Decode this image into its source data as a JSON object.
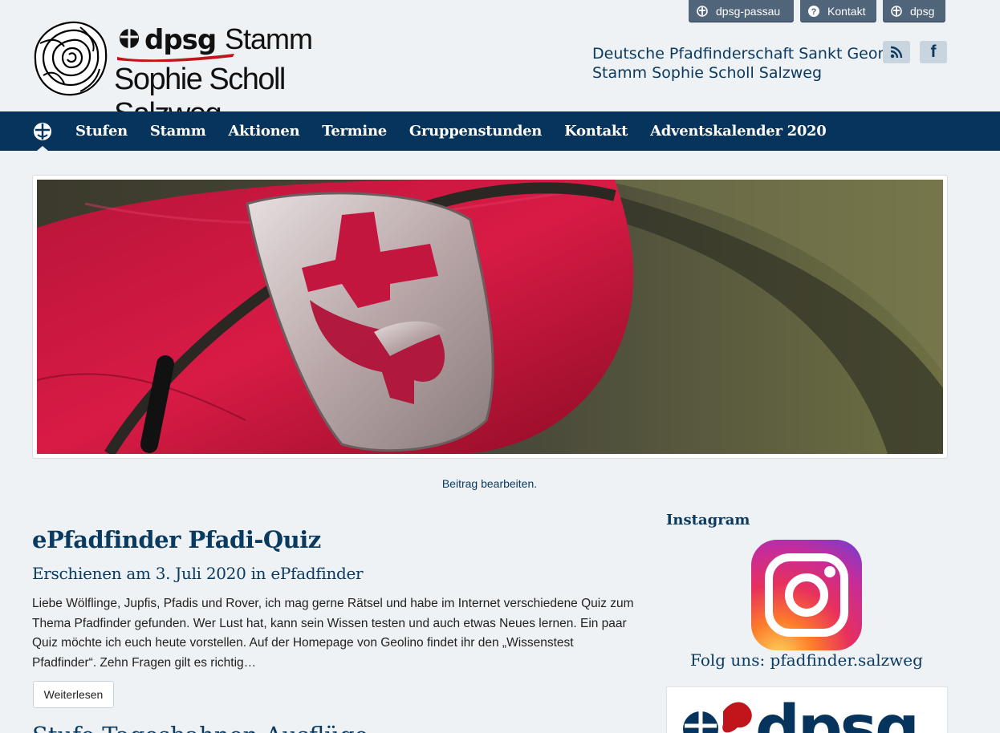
{
  "top_links": [
    {
      "label": "dpsg-passau",
      "icon": "lily-icon"
    },
    {
      "label": "Kontakt",
      "icon": "question-icon"
    },
    {
      "label": "dpsg",
      "icon": "lily-icon"
    }
  ],
  "logo": {
    "brand": "dpsg",
    "stamm": "Stamm",
    "name": "Sophie Scholl Salzweg"
  },
  "tagline": {
    "line1": "Deutsche Pfadfinderschaft Sankt Georg",
    "line2": "Stamm Sophie Scholl Salzweg"
  },
  "social": [
    {
      "icon": "rss-icon"
    },
    {
      "icon": "facebook-icon",
      "glyph": "f"
    }
  ],
  "nav": {
    "items": [
      "Stufen",
      "Stamm",
      "Aktionen",
      "Termine",
      "Gruppenstunden",
      "Kontakt",
      "Adventskalender 2020"
    ]
  },
  "edit_link": "Beitrag bearbeiten.",
  "article": {
    "title": "ePfadfinder Pfadi-Quiz",
    "meta": "Erschienen am 3. Juli 2020 in ePfadfinder",
    "body": "Liebe Wölflinge, Jupfis, Pfadis und Rover, ich mag gerne Rätsel und habe im Internet verschiedene Quiz zum Thema Pfadfinder gefunden. Wer Lust hat, kann sein Wissen testen und auch etwas Neues lernen. Ein paar Quiz möchte ich euch heute vorstellen. Auf der Homepage von Geolino findet ihr den „Wissenstest Pfadfinder“. Zehn Fragen gilt es richtig…",
    "read_more": "Weiterlesen",
    "next_title": "Stufe Tagesbahnen Ausflüge"
  },
  "sidebar": {
    "heading": "Instagram",
    "follow": "Folg uns: pfadfinder.salzweg"
  },
  "colors": {
    "navy": "#07345c",
    "background": "#eef2f5",
    "toplink": "#50647a"
  }
}
